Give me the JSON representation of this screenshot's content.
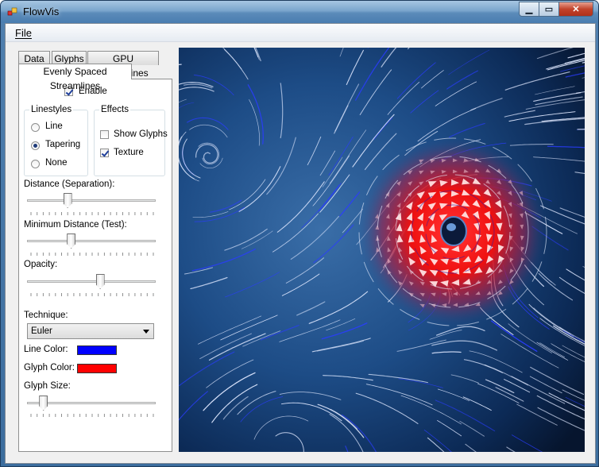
{
  "window": {
    "title": "FlowVis"
  },
  "menu": {
    "file_label": "File"
  },
  "tabs": [
    {
      "label": "Data"
    },
    {
      "label": "Glyphs"
    },
    {
      "label": "GPU Streamlines"
    },
    {
      "label": "Evenly Spaced Streamlines"
    }
  ],
  "panel": {
    "enable_label": "Enable",
    "enable_checked": true,
    "linestyles": {
      "title": "Linestyles",
      "options": [
        "Line",
        "Tapering",
        "None"
      ],
      "selected": "Tapering"
    },
    "effects": {
      "title": "Effects",
      "show_glyphs_label": "Show Glyphs",
      "show_glyphs_checked": false,
      "texture_label": "Texture",
      "texture_checked": true
    },
    "distance": {
      "label": "Distance (Separation):",
      "value": 0.3
    },
    "min_distance": {
      "label": "Minimum Distance (Test):",
      "value": 0.33
    },
    "opacity": {
      "label": "Opacity:",
      "value": 0.57
    },
    "technique": {
      "label": "Technique:",
      "value": "Euler"
    },
    "line_color": {
      "label": "Line Color:",
      "color": "#0000ff"
    },
    "glyph_color": {
      "label": "Glyph Color:",
      "color": "#ff0000"
    },
    "glyph_size": {
      "label": "Glyph Size:",
      "value": 0.1
    }
  },
  "colors": {
    "vis_background": "#0b2a55",
    "vis_core": "#ff1a1a",
    "streamline": "#dfe8ff"
  }
}
